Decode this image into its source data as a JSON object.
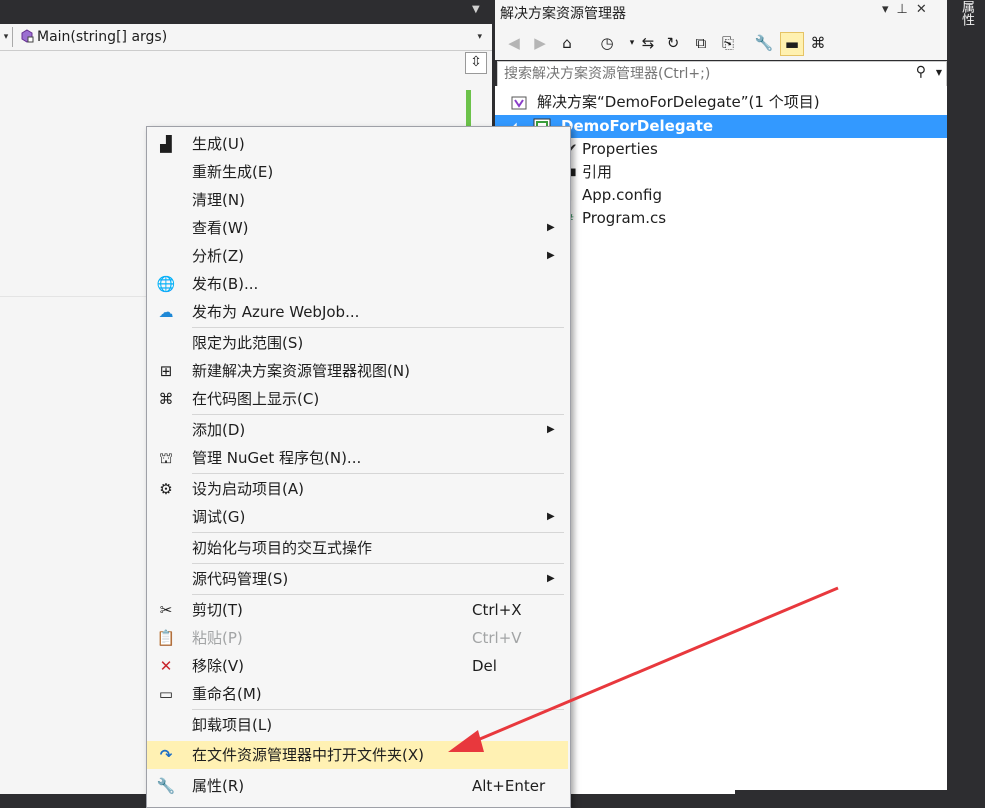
{
  "editor": {
    "member_dropdown": "Main(string[] args)",
    "member_icon": "method-icon"
  },
  "solution_explorer": {
    "title": "解决方案资源管理器",
    "title_controls": [
      "▾",
      "⊥",
      "✕"
    ],
    "search_placeholder": "搜索解决方案资源管理器(Ctrl+;)",
    "tree": [
      {
        "label": "解决方案“DemoForDelegate”(1 个项目)",
        "icon": "solution-icon"
      },
      {
        "label": "DemoForDelegate",
        "icon": "csharp-project-icon",
        "selected": true
      },
      {
        "label": "Properties",
        "icon": "wrench-icon"
      },
      {
        "label": "引用",
        "icon": "references-icon"
      },
      {
        "label": "App.config",
        "icon": "config-file-icon"
      },
      {
        "label": "Program.cs",
        "icon": "csharp-file-icon"
      }
    ]
  },
  "right_tab": "属性",
  "context_menu": {
    "items": [
      {
        "label": "生成(U)",
        "icon": "build-icon"
      },
      {
        "label": "重新生成(E)"
      },
      {
        "label": "清理(N)"
      },
      {
        "label": "查看(W)",
        "submenu": true
      },
      {
        "label": "分析(Z)",
        "submenu": true
      },
      {
        "label": "发布(B)...",
        "icon": "publish-globe-icon"
      },
      {
        "label": "发布为 Azure WebJob...",
        "icon": "azure-cloud-icon"
      },
      {
        "label": "限定为此范围(S)"
      },
      {
        "label": "新建解决方案资源管理器视图(N)",
        "icon": "new-view-icon"
      },
      {
        "label": "在代码图上显示(C)",
        "icon": "code-map-icon"
      },
      {
        "label": "添加(D)",
        "submenu": true
      },
      {
        "label": "管理 NuGet 程序包(N)...",
        "icon": "nuget-icon"
      },
      {
        "label": "设为启动项目(A)",
        "icon": "gear-icon"
      },
      {
        "label": "调试(G)",
        "submenu": true
      },
      {
        "label": "初始化与项目的交互式操作"
      },
      {
        "label": "源代码管理(S)",
        "submenu": true
      },
      {
        "label": "剪切(T)",
        "shortcut": "Ctrl+X",
        "icon": "scissors-icon"
      },
      {
        "label": "粘贴(P)",
        "shortcut": "Ctrl+V",
        "icon": "paste-icon",
        "disabled": true
      },
      {
        "label": "移除(V)",
        "shortcut": "Del",
        "icon": "remove-x-icon"
      },
      {
        "label": "重命名(M)",
        "icon": "rename-icon"
      },
      {
        "label": "卸载项目(L)"
      },
      {
        "label": "在文件资源管理器中打开文件夹(X)",
        "icon": "open-folder-arrow-icon",
        "highlighted": true
      },
      {
        "label": "属性(R)",
        "shortcut": "Alt+Enter",
        "icon": "wrench-icon"
      }
    ]
  },
  "colors": {
    "selection": "#3399ff",
    "highlight": "#fff1b3",
    "arrow": "#e8383d",
    "dark_chrome": "#2d2d30"
  }
}
